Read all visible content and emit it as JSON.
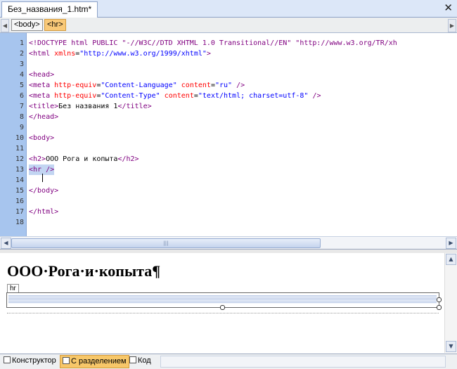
{
  "tab": {
    "title": "Без_названия_1.htm*",
    "close": "✕"
  },
  "tag_selector": {
    "left_arrow": "◀",
    "right_arrow": "▶",
    "tags": [
      "<body>",
      "<hr>"
    ]
  },
  "code": {
    "line_numbers": [
      "1",
      "2",
      "3",
      "4",
      "5",
      "6",
      "7",
      "8",
      "9",
      "10",
      "11",
      "12",
      "13",
      "14",
      "15",
      "16",
      "17",
      "18"
    ],
    "lines": [
      [
        [
          "t",
          "<!DOCTYPE html PUBLIC \"-//W3C//DTD XHTML 1.0 Transitional//EN\" \"http://www.w3.org/TR/xh"
        ]
      ],
      [
        [
          "t",
          "<html "
        ],
        [
          "a",
          "xmlns"
        ],
        [
          "tx",
          "="
        ],
        [
          "v",
          "\"http://www.w3.org/1999/xhtml\""
        ],
        [
          "t",
          ">"
        ]
      ],
      [],
      [
        [
          "t",
          "<head>"
        ]
      ],
      [
        [
          "t",
          "<meta "
        ],
        [
          "a",
          "http-equiv"
        ],
        [
          "tx",
          "="
        ],
        [
          "v",
          "\"Content-Language\""
        ],
        [
          "tx",
          " "
        ],
        [
          "a",
          "content"
        ],
        [
          "tx",
          "="
        ],
        [
          "v",
          "\"ru\""
        ],
        [
          "tx",
          " "
        ],
        [
          "t",
          "/>"
        ]
      ],
      [
        [
          "t",
          "<meta "
        ],
        [
          "a",
          "http-equiv"
        ],
        [
          "tx",
          "="
        ],
        [
          "v",
          "\"Content-Type\""
        ],
        [
          "tx",
          " "
        ],
        [
          "a",
          "content"
        ],
        [
          "tx",
          "="
        ],
        [
          "v",
          "\"text/html; charset=utf-8\""
        ],
        [
          "tx",
          " "
        ],
        [
          "t",
          "/>"
        ]
      ],
      [
        [
          "t",
          "<title>"
        ],
        [
          "tx",
          "Без названия 1"
        ],
        [
          "t",
          "</title>"
        ]
      ],
      [
        [
          "t",
          "</head>"
        ]
      ],
      [],
      [
        [
          "t",
          "<body>"
        ]
      ],
      [],
      [
        [
          "t",
          "<h2>"
        ],
        [
          "tx",
          "ООО Рога и копыта"
        ],
        [
          "t",
          "</h2>"
        ]
      ],
      [
        [
          "t",
          "<hr"
        ],
        [
          "tx",
          " "
        ],
        [
          "t",
          "/>"
        ]
      ],
      [],
      [
        [
          "t",
          "</body>"
        ]
      ],
      [],
      [
        [
          "t",
          "</html>"
        ]
      ],
      []
    ]
  },
  "design_view": {
    "heading": "ООО·Рога·и·копыта¶",
    "hr_label": "hr"
  },
  "scrollbar": {
    "left": "◀",
    "right": "▶",
    "up": "▲",
    "down": "▼",
    "grip": "|||"
  },
  "view_tabs": [
    "Конструктор",
    "С разделением",
    "Код"
  ],
  "active_view": "С разделением"
}
